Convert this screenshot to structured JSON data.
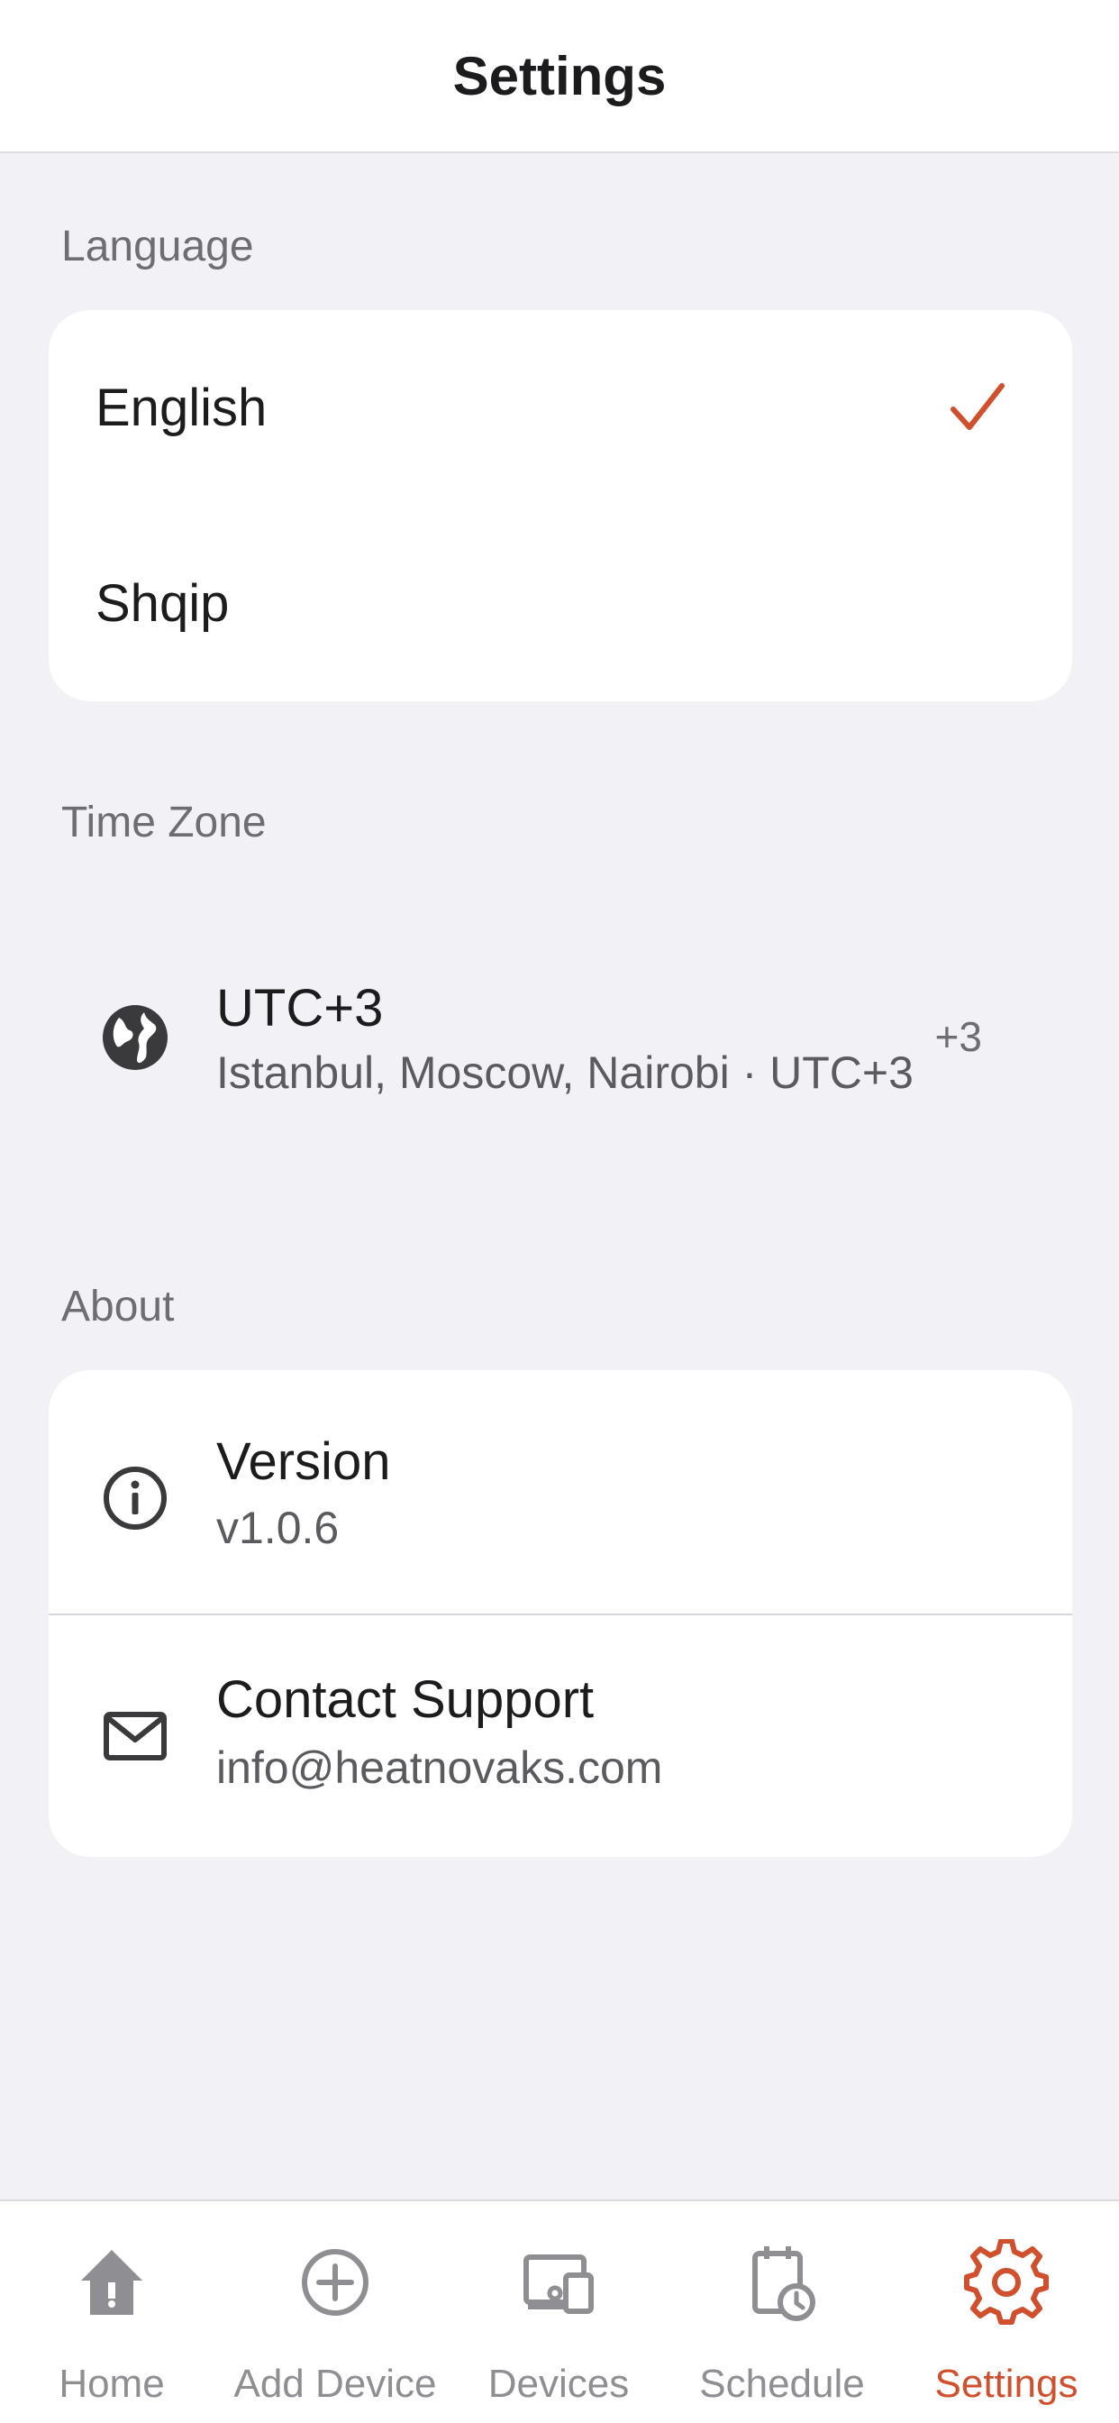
{
  "header": {
    "title": "Settings"
  },
  "colors": {
    "accent": "#d0502d",
    "inactive": "#8e8e93",
    "background": "#f2f2f6"
  },
  "language": {
    "section_label": "Language",
    "options": [
      {
        "label": "English",
        "selected": true
      },
      {
        "label": "Shqip",
        "selected": false
      }
    ]
  },
  "timezone": {
    "section_label": "Time Zone",
    "icon": "globe-icon",
    "title": "UTC+3",
    "subtitle": "Istanbul, Moscow, Nairobi · UTC+3",
    "offset": "+3"
  },
  "about": {
    "section_label": "About",
    "version": {
      "icon": "info-icon",
      "title": "Version",
      "value": "v1.0.6"
    },
    "support": {
      "icon": "mail-icon",
      "title": "Contact Support",
      "value": "info@heatnovaks.com"
    }
  },
  "tabs": [
    {
      "label": "Home",
      "icon": "home-icon",
      "active": false
    },
    {
      "label": "Add Device",
      "icon": "plus-circle-icon",
      "active": false
    },
    {
      "label": "Devices",
      "icon": "devices-icon",
      "active": false
    },
    {
      "label": "Schedule",
      "icon": "schedule-icon",
      "active": false
    },
    {
      "label": "Settings",
      "icon": "gear-icon",
      "active": true
    }
  ]
}
